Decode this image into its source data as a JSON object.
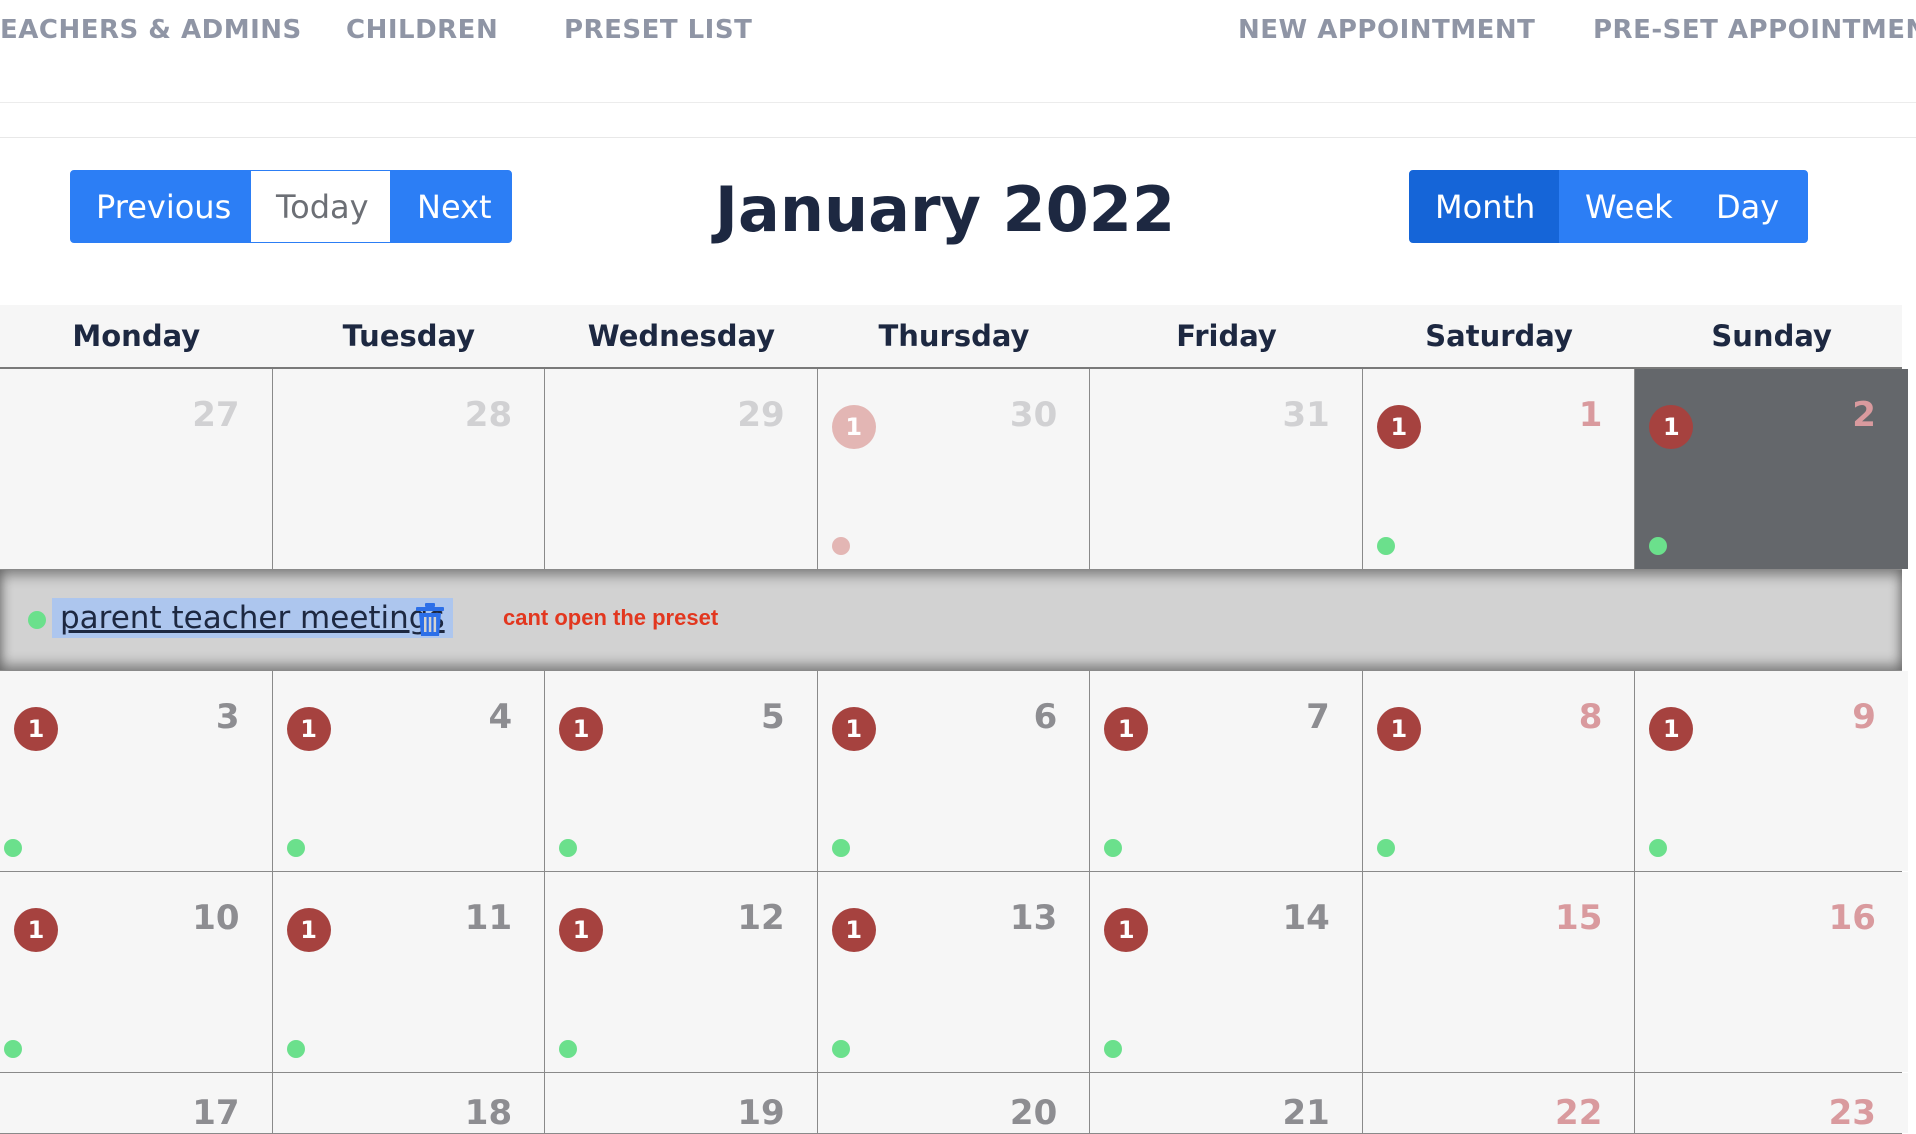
{
  "nav": {
    "items": [
      {
        "label": "EACHERS & ADMINS"
      },
      {
        "label": "CHILDREN"
      },
      {
        "label": "PRESET LIST"
      },
      {
        "label": "NEW APPOINTMENT"
      },
      {
        "label": "PRE-SET APPOINTMENT"
      }
    ]
  },
  "toolbar": {
    "previous_label": "Previous",
    "today_label": "Today",
    "next_label": "Next",
    "month_label": "Month",
    "week_label": "Week",
    "day_label": "Day",
    "title": "January 2022"
  },
  "calendar": {
    "weekdays": [
      "Monday",
      "Tuesday",
      "Wednesday",
      "Thursday",
      "Friday",
      "Saturday",
      "Sunday"
    ],
    "weeks": [
      [
        {
          "day": "27",
          "outside": true
        },
        {
          "day": "28",
          "outside": true
        },
        {
          "day": "29",
          "outside": true
        },
        {
          "day": "30",
          "outside": true,
          "badge": "1",
          "dot": true,
          "faded": true
        },
        {
          "day": "31",
          "outside": true
        },
        {
          "day": "1",
          "weekend": true,
          "badge": "1",
          "dot": true
        },
        {
          "day": "2",
          "weekend": true,
          "badge": "1",
          "dot": true,
          "selected": true
        }
      ],
      [
        {
          "day": "3",
          "badge": "1",
          "dot": true
        },
        {
          "day": "4",
          "badge": "1",
          "dot": true
        },
        {
          "day": "5",
          "badge": "1",
          "dot": true
        },
        {
          "day": "6",
          "badge": "1",
          "dot": true
        },
        {
          "day": "7",
          "badge": "1",
          "dot": true
        },
        {
          "day": "8",
          "weekend": true,
          "badge": "1",
          "dot": true
        },
        {
          "day": "9",
          "weekend": true,
          "badge": "1",
          "dot": true
        }
      ],
      [
        {
          "day": "10",
          "badge": "1",
          "dot": true
        },
        {
          "day": "11",
          "badge": "1",
          "dot": true
        },
        {
          "day": "12",
          "badge": "1",
          "dot": true
        },
        {
          "day": "13",
          "badge": "1",
          "dot": true
        },
        {
          "day": "14",
          "badge": "1",
          "dot": true
        },
        {
          "day": "15",
          "weekend": true
        },
        {
          "day": "16",
          "weekend": true
        }
      ],
      [
        {
          "day": "17"
        },
        {
          "day": "18"
        },
        {
          "day": "19"
        },
        {
          "day": "20"
        },
        {
          "day": "21"
        },
        {
          "day": "22",
          "weekend": true
        },
        {
          "day": "23",
          "weekend": true
        }
      ]
    ],
    "expanded_event": {
      "title": "parent teacher meetings",
      "note": "cant open the preset"
    }
  },
  "colors": {
    "primary": "#2c7ef5",
    "active": "#1565d8",
    "badge": "#a6423f",
    "dot": "#6be08c",
    "note": "#e2371f"
  },
  "icons": {
    "delete": "trash-icon"
  }
}
